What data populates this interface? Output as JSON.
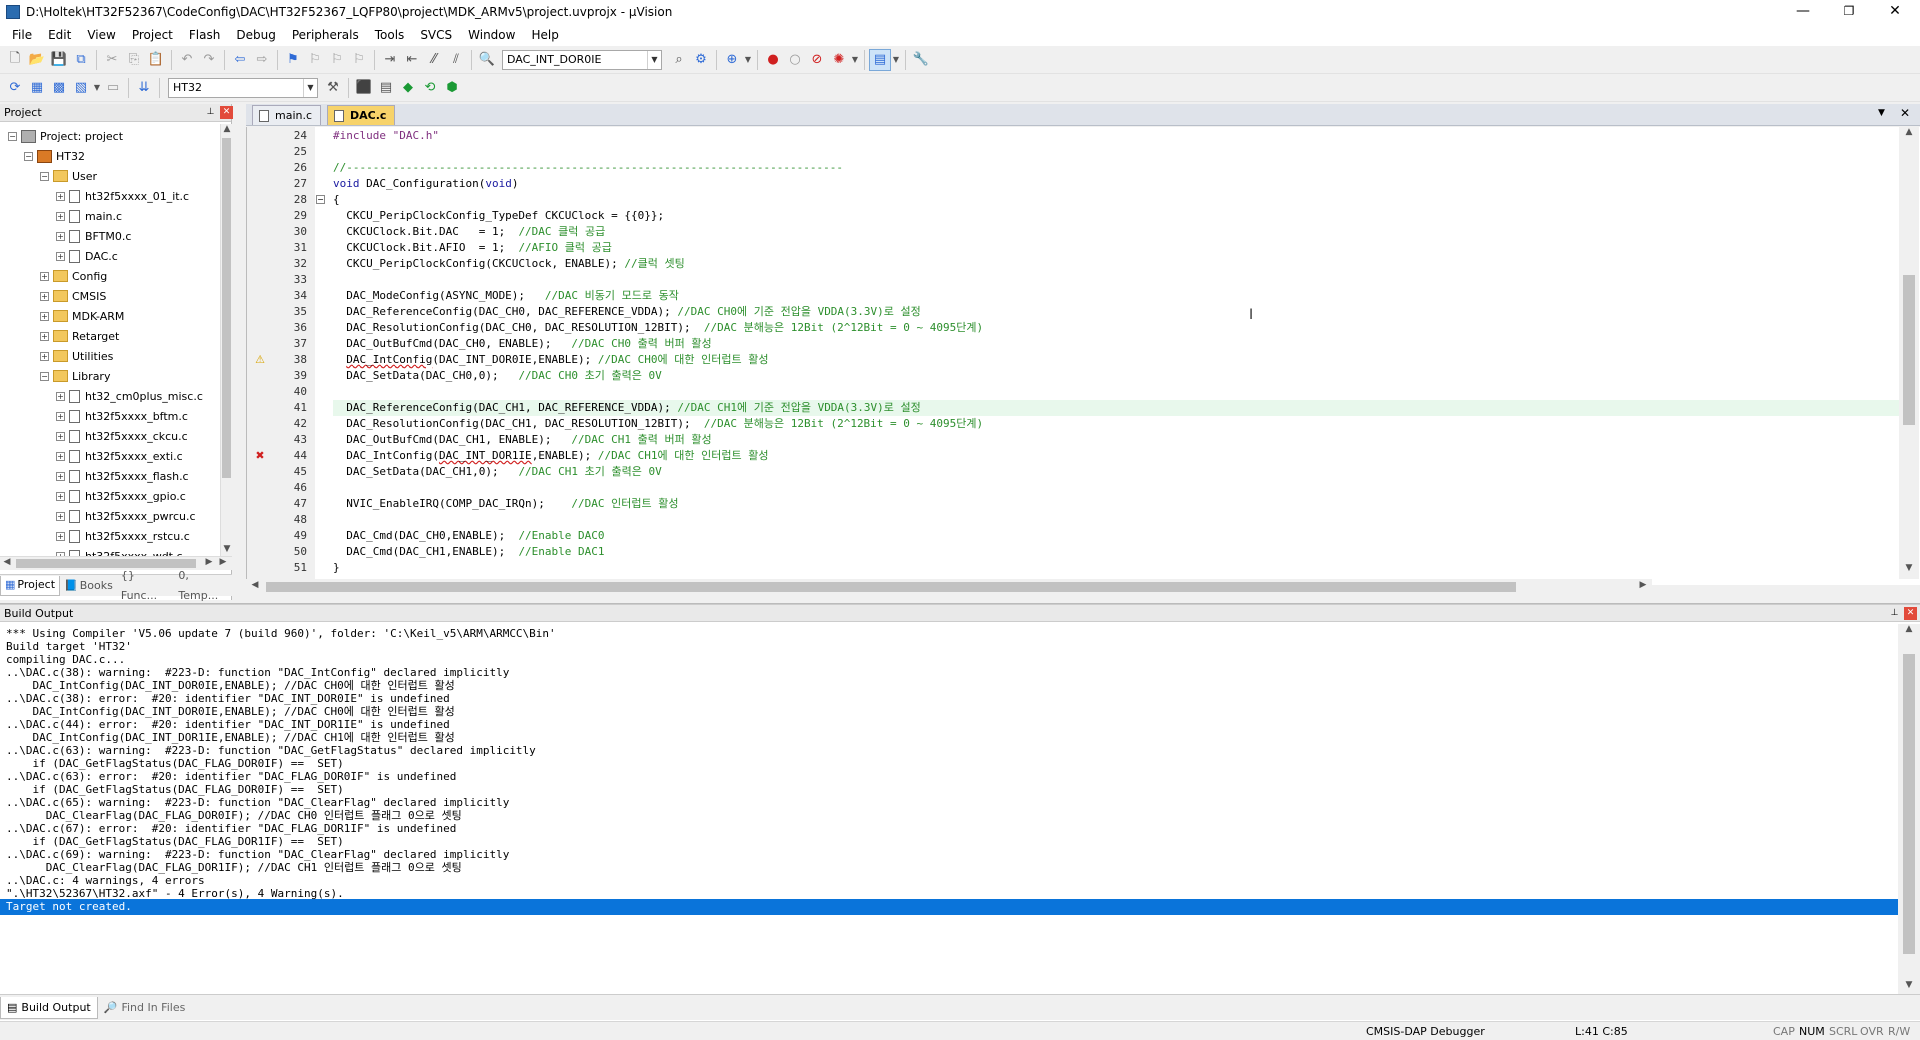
{
  "window": {
    "title": "D:\\Holtek\\HT32F52367\\CodeConfig\\DAC\\HT32F52367_LQFP80\\project\\MDK_ARMv5\\project.uvprojx - µVision",
    "minimize": "—",
    "maximize": "❐",
    "close": "✕"
  },
  "menu": [
    "File",
    "Edit",
    "View",
    "Project",
    "Flash",
    "Debug",
    "Peripherals",
    "Tools",
    "SVCS",
    "Window",
    "Help"
  ],
  "toolbar1": {
    "find_combo": "DAC_INT_DOR0IE"
  },
  "toolbar2": {
    "target_combo": "HT32"
  },
  "project_panel": {
    "title": "Project",
    "tree": [
      {
        "label": "Project: project",
        "level": 0,
        "kind": "project",
        "expander": "−"
      },
      {
        "label": "HT32",
        "level": 1,
        "kind": "target",
        "expander": "−"
      },
      {
        "label": "User",
        "level": 2,
        "kind": "folder",
        "expander": "−"
      },
      {
        "label": "ht32f5xxxx_01_it.c",
        "level": 3,
        "kind": "file",
        "expander": "+"
      },
      {
        "label": "main.c",
        "level": 3,
        "kind": "file",
        "expander": "+"
      },
      {
        "label": "BFTM0.c",
        "level": 3,
        "kind": "file",
        "expander": "+"
      },
      {
        "label": "DAC.c",
        "level": 3,
        "kind": "file",
        "expander": "+"
      },
      {
        "label": "Config",
        "level": 2,
        "kind": "folder",
        "expander": "+"
      },
      {
        "label": "CMSIS",
        "level": 2,
        "kind": "folder",
        "expander": "+"
      },
      {
        "label": "MDK-ARM",
        "level": 2,
        "kind": "folder",
        "expander": "+"
      },
      {
        "label": "Retarget",
        "level": 2,
        "kind": "folder",
        "expander": "+"
      },
      {
        "label": "Utilities",
        "level": 2,
        "kind": "folder",
        "expander": "+"
      },
      {
        "label": "Library",
        "level": 2,
        "kind": "folder",
        "expander": "−"
      },
      {
        "label": "ht32_cm0plus_misc.c",
        "level": 3,
        "kind": "file",
        "expander": "+"
      },
      {
        "label": "ht32f5xxxx_bftm.c",
        "level": 3,
        "kind": "file",
        "expander": "+"
      },
      {
        "label": "ht32f5xxxx_ckcu.c",
        "level": 3,
        "kind": "file",
        "expander": "+"
      },
      {
        "label": "ht32f5xxxx_exti.c",
        "level": 3,
        "kind": "file",
        "expander": "+"
      },
      {
        "label": "ht32f5xxxx_flash.c",
        "level": 3,
        "kind": "file",
        "expander": "+"
      },
      {
        "label": "ht32f5xxxx_gpio.c",
        "level": 3,
        "kind": "file",
        "expander": "+"
      },
      {
        "label": "ht32f5xxxx_pwrcu.c",
        "level": 3,
        "kind": "file",
        "expander": "+"
      },
      {
        "label": "ht32f5xxxx_rstcu.c",
        "level": 3,
        "kind": "file",
        "expander": "+"
      },
      {
        "label": "ht32f5xxxx_wdt.c",
        "level": 3,
        "kind": "file",
        "expander": "+"
      }
    ],
    "tabs": [
      "Project",
      "Books",
      "{} Func...",
      "0, Temp..."
    ]
  },
  "editor": {
    "tabs": [
      {
        "label": "main.c",
        "active": false
      },
      {
        "label": "DAC.c",
        "active": true
      }
    ],
    "lines": [
      {
        "n": "24",
        "parts": [
          [
            "pp",
            "#include \"DAC.h\""
          ]
        ]
      },
      {
        "n": "25",
        "parts": []
      },
      {
        "n": "26",
        "parts": [
          [
            "com",
            "//---------------------------------------------------------------------------"
          ]
        ]
      },
      {
        "n": "27",
        "parts": [
          [
            "kw",
            "void"
          ],
          [
            "",
            " DAC_Configuration("
          ],
          [
            "kw",
            "void"
          ],
          [
            "",
            ")"
          ]
        ]
      },
      {
        "n": "28",
        "parts": [
          [
            "",
            "{"
          ]
        ],
        "fold": "−"
      },
      {
        "n": "29",
        "parts": [
          [
            "",
            "  CKCU_PeripClockConfig_TypeDef CKCUClock = {{0}};"
          ]
        ]
      },
      {
        "n": "30",
        "parts": [
          [
            "",
            "  CKCUClock.Bit.DAC   = 1;  "
          ],
          [
            "com",
            "//DAC 클럭 공급"
          ]
        ]
      },
      {
        "n": "31",
        "parts": [
          [
            "",
            "  CKCUClock.Bit.AFIO  = 1;  "
          ],
          [
            "com",
            "//AFIO 클럭 공급"
          ]
        ]
      },
      {
        "n": "32",
        "parts": [
          [
            "",
            "  CKCU_PeripClockConfig(CKCUClock, ENABLE); "
          ],
          [
            "com",
            "//클럭 셋팅"
          ]
        ]
      },
      {
        "n": "33",
        "parts": []
      },
      {
        "n": "34",
        "parts": [
          [
            "",
            "  DAC_ModeConfig(ASYNC_MODE);   "
          ],
          [
            "com",
            "//DAC 비동기 모드로 동작"
          ]
        ]
      },
      {
        "n": "35",
        "parts": [
          [
            "",
            "  DAC_ReferenceConfig(DAC_CH0, DAC_REFERENCE_VDDA); "
          ],
          [
            "com",
            "//DAC CH0에 기준 전압을 VDDA(3.3V)로 설정"
          ]
        ]
      },
      {
        "n": "36",
        "parts": [
          [
            "",
            "  DAC_ResolutionConfig(DAC_CH0, DAC_RESOLUTION_12BIT);  "
          ],
          [
            "com",
            "//DAC 분해능은 12Bit (2^12Bit = 0 ~ 4095단계)"
          ]
        ]
      },
      {
        "n": "37",
        "parts": [
          [
            "",
            "  DAC_OutBufCmd(DAC_CH0, ENABLE);   "
          ],
          [
            "com",
            "//DAC CH0 출력 버퍼 활성"
          ]
        ]
      },
      {
        "n": "38",
        "parts": [
          [
            "",
            "  "
          ],
          [
            "squig",
            "DAC_IntConfig"
          ],
          [
            "",
            "(DAC_INT_DOR0IE,ENABLE); "
          ],
          [
            "com",
            "//DAC CH0에 대한 인터럽트 활성"
          ]
        ],
        "mark": "warn"
      },
      {
        "n": "39",
        "parts": [
          [
            "",
            "  DAC_SetData(DAC_CH0,0);   "
          ],
          [
            "com",
            "//DAC CH0 초기 출력은 0V"
          ]
        ]
      },
      {
        "n": "40",
        "parts": []
      },
      {
        "n": "41",
        "parts": [
          [
            "",
            "  DAC_ReferenceConfig(DAC_CH1, DAC_REFERENCE_VDDA); "
          ],
          [
            "com",
            "//DAC CH1에 기준 전압을 VDDA(3.3V)로 설정"
          ]
        ],
        "hl": true
      },
      {
        "n": "42",
        "parts": [
          [
            "",
            "  DAC_ResolutionConfig(DAC_CH1, DAC_RESOLUTION_12BIT);  "
          ],
          [
            "com",
            "//DAC 분해능은 12Bit (2^12Bit = 0 ~ 4095단계)"
          ]
        ]
      },
      {
        "n": "43",
        "parts": [
          [
            "",
            "  DAC_OutBufCmd(DAC_CH1, ENABLE);   "
          ],
          [
            "com",
            "//DAC CH1 출력 버퍼 활성"
          ]
        ]
      },
      {
        "n": "44",
        "parts": [
          [
            "",
            "  DAC_IntConfig("
          ],
          [
            "squig",
            "DAC_INT_DOR1IE"
          ],
          [
            "",
            ",ENABLE); "
          ],
          [
            "com",
            "//DAC CH1에 대한 인터럽트 활성"
          ]
        ],
        "mark": "error"
      },
      {
        "n": "45",
        "parts": [
          [
            "",
            "  DAC_SetData(DAC_CH1,0);   "
          ],
          [
            "com",
            "//DAC CH1 초기 출력은 0V"
          ]
        ]
      },
      {
        "n": "46",
        "parts": []
      },
      {
        "n": "47",
        "parts": [
          [
            "",
            "  NVIC_EnableIRQ(COMP_DAC_IRQn);    "
          ],
          [
            "com",
            "//DAC 인터럽트 활성"
          ]
        ]
      },
      {
        "n": "48",
        "parts": []
      },
      {
        "n": "49",
        "parts": [
          [
            "",
            "  DAC_Cmd(DAC_CH0,ENABLE);  "
          ],
          [
            "com",
            "//Enable DAC0"
          ]
        ]
      },
      {
        "n": "50",
        "parts": [
          [
            "",
            "  DAC_Cmd(DAC_CH1,ENABLE);  "
          ],
          [
            "com",
            "//Enable DAC1"
          ]
        ]
      },
      {
        "n": "51",
        "parts": [
          [
            "",
            "}"
          ]
        ]
      }
    ]
  },
  "build_output": {
    "title": "Build Output",
    "lines": [
      "*** Using Compiler 'V5.06 update 7 (build 960)', folder: 'C:\\Keil_v5\\ARM\\ARMCC\\Bin'",
      "Build target 'HT32'",
      "compiling DAC.c...",
      "..\\DAC.c(38): warning:  #223-D: function \"DAC_IntConfig\" declared implicitly",
      "    DAC_IntConfig(DAC_INT_DOR0IE,ENABLE); //DAC CH0에 대한 인터럽트 활성",
      "..\\DAC.c(38): error:  #20: identifier \"DAC_INT_DOR0IE\" is undefined",
      "    DAC_IntConfig(DAC_INT_DOR0IE,ENABLE); //DAC CH0에 대한 인터럽트 활성",
      "..\\DAC.c(44): error:  #20: identifier \"DAC_INT_DOR1IE\" is undefined",
      "    DAC_IntConfig(DAC_INT_DOR1IE,ENABLE); //DAC CH1에 대한 인터럽트 활성",
      "..\\DAC.c(63): warning:  #223-D: function \"DAC_GetFlagStatus\" declared implicitly",
      "    if (DAC_GetFlagStatus(DAC_FLAG_DOR0IF) ==  SET)",
      "..\\DAC.c(63): error:  #20: identifier \"DAC_FLAG_DOR0IF\" is undefined",
      "    if (DAC_GetFlagStatus(DAC_FLAG_DOR0IF) ==  SET)",
      "..\\DAC.c(65): warning:  #223-D: function \"DAC_ClearFlag\" declared implicitly",
      "      DAC_ClearFlag(DAC_FLAG_DOR0IF); //DAC CH0 인터럽트 플래그 0으로 셋팅",
      "..\\DAC.c(67): error:  #20: identifier \"DAC_FLAG_DOR1IF\" is undefined",
      "    if (DAC_GetFlagStatus(DAC_FLAG_DOR1IF) ==  SET)",
      "..\\DAC.c(69): warning:  #223-D: function \"DAC_ClearFlag\" declared implicitly",
      "      DAC_ClearFlag(DAC_FLAG_DOR1IF); //DAC CH1 인터럽트 플래그 0으로 셋팅",
      "..\\DAC.c: 4 warnings, 4 errors",
      "\".\\HT32\\52367\\HT32.axf\" - 4 Error(s), 4 Warning(s).",
      "Target not created."
    ],
    "tabs": [
      "Build Output",
      "Find In Files"
    ]
  },
  "status": {
    "debugger": "CMSIS-DAP Debugger",
    "position": "L:41 C:85",
    "caps": "CAP",
    "num": "NUM",
    "scrl": "SCRL",
    "ovr": "OVR",
    "rw": "R/W"
  }
}
